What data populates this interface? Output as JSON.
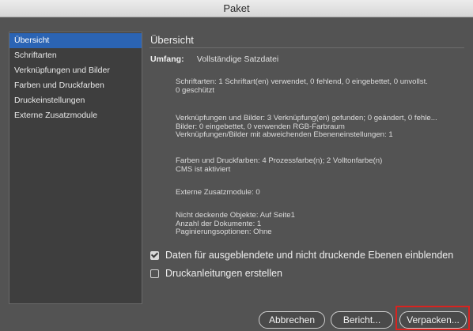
{
  "window": {
    "title": "Paket"
  },
  "sidebar": {
    "items": [
      {
        "label": "Übersicht",
        "selected": true
      },
      {
        "label": "Schriftarten",
        "selected": false
      },
      {
        "label": "Verknüpfungen und Bilder",
        "selected": false
      },
      {
        "label": "Farben und Druckfarben",
        "selected": false
      },
      {
        "label": "Druckeinstellungen",
        "selected": false
      },
      {
        "label": "Externe Zusatzmodule",
        "selected": false
      }
    ]
  },
  "main": {
    "title": "Übersicht",
    "umfang_label": "Umfang:",
    "umfang_value": "Vollständige Satzdatei",
    "fonts": {
      "line1": "Schriftarten: 1 Schriftart(en) verwendet, 0 fehlend, 0 eingebettet, 0 unvollst.",
      "line2": "0 geschützt"
    },
    "links": {
      "line1": "Verknüpfungen und Bilder: 3 Verknüpfung(en) gefunden; 0 geändert, 0 fehle...",
      "line2": "Bilder: 0 eingebettet, 0 verwenden RGB-Farbraum",
      "line3": "Verknüpfungen/Bilder mit abweichenden Ebeneneinstellungen: 1"
    },
    "colors": {
      "line1": "Farben und Druckfarben: 4 Prozessfarbe(n); 2 Volltonfarbe(n)",
      "line2": "CMS ist aktiviert"
    },
    "plugins": {
      "line1": "Externe Zusatzmodule: 0"
    },
    "misc": {
      "line1": "Nicht deckende Objekte: Auf Seite1",
      "line2": "Anzahl der Dokumente: 1",
      "line3": "Paginierungsoptionen: Ohne"
    },
    "checkbox_hidden_layers": {
      "label": "Daten für ausgeblendete und nicht druckende Ebenen einblenden",
      "checked": true
    },
    "checkbox_instructions": {
      "label": "Druckanleitungen erstellen",
      "checked": false
    }
  },
  "buttons": {
    "cancel": "Abbrechen",
    "report": "Bericht...",
    "package": "Verpacken..."
  },
  "colors": {
    "dialog_bg": "#535353",
    "sidebar_bg": "#3e3e3e",
    "selection": "#2b64b4",
    "highlight": "#d9231f"
  }
}
